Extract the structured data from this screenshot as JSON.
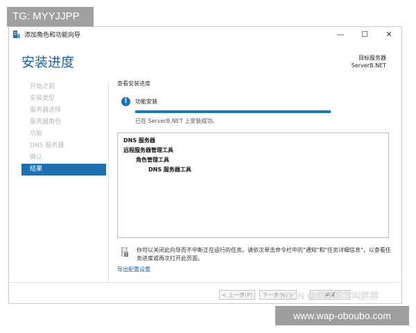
{
  "watermark_top": "TG: MYYJJPP",
  "watermark_bottom": "www.wap-oboubo.com",
  "watermark_csdn": "CSDN @胖胖同学叫胖胖",
  "window": {
    "title": "添加角色和功能向导",
    "controls": {
      "minimize": "—",
      "maximize": "☐",
      "close": "✕"
    }
  },
  "page_title": "安装进度",
  "target_server": {
    "label": "目标服务器",
    "name": "ServerB.NET"
  },
  "nav": {
    "items": [
      {
        "label": "开始之前",
        "state": "disabled"
      },
      {
        "label": "安装类型",
        "state": "disabled"
      },
      {
        "label": "服务器选择",
        "state": "disabled"
      },
      {
        "label": "服务器角色",
        "state": "disabled"
      },
      {
        "label": "功能",
        "state": "disabled"
      },
      {
        "label": "DNS 服务器",
        "state": "disabled"
      },
      {
        "label": "确认",
        "state": "disabled"
      },
      {
        "label": "结果",
        "state": "active"
      }
    ]
  },
  "main": {
    "section_label": "查看安装进度",
    "feature_label": "功能安装",
    "progress": 1.0,
    "status": "已在 ServerB.NET 上安装成功。",
    "results": [
      {
        "text": "DNS 服务器",
        "indent": 0
      },
      {
        "text": "远程服务器管理工具",
        "indent": 0
      },
      {
        "text": "角色管理工具",
        "indent": 1
      },
      {
        "text": "DNS 服务器工具",
        "indent": 2
      }
    ],
    "note": "你可以关闭此向导而不中断正在运行的任务。请依次单击命令栏中的\"通知\"和\"任务详细信息\"，以查看任务进度或再次打开此页面。",
    "export_link": "导出配置设置"
  },
  "buttons": {
    "prev": "< 上一步(P)",
    "next": "下一步(N) >",
    "close": "关闭"
  },
  "colors": {
    "accent": "#1f6fb3",
    "title": "#1a5f9e",
    "progress": "#1b7ab8"
  }
}
